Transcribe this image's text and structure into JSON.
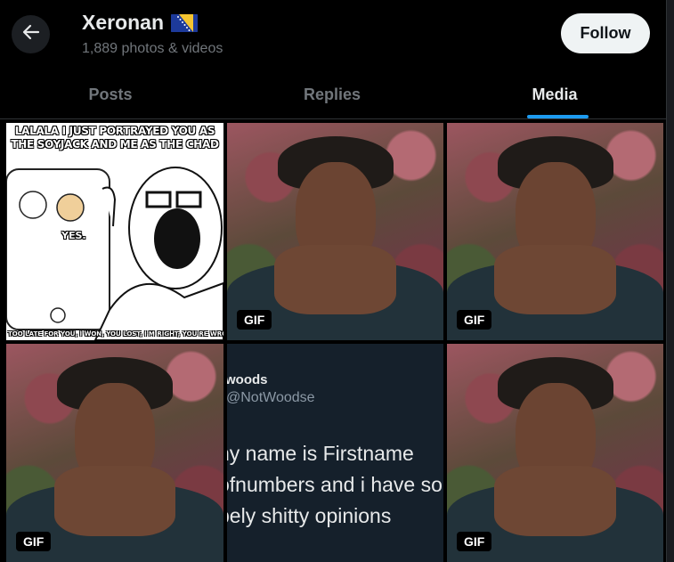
{
  "header": {
    "name": "Xeronan",
    "count": "1,889 photos & videos",
    "follow_label": "Follow"
  },
  "tabs": [
    {
      "label": "Posts",
      "active": false
    },
    {
      "label": "Replies",
      "active": false
    },
    {
      "label": "Media",
      "active": true
    }
  ],
  "accent_color": "#1d9bf0",
  "media": [
    {
      "kind": "meme",
      "top_text": "LALALA I JUST PORTRAYED YOU AS THE SOYJACK AND ME AS THE CHAD",
      "yes_text": "YES.",
      "bottom_text": "TOO LATE FOR YOU, I WON, YOU LOST, I'M RIGHT, YOU'RE WRONG, LALALA"
    },
    {
      "kind": "gif",
      "badge": "GIF"
    },
    {
      "kind": "gif",
      "badge": "GIF"
    },
    {
      "kind": "gif",
      "badge": "GIF"
    },
    {
      "kind": "tweet",
      "name": "woods",
      "handle": "@NotWoodse",
      "lines": [
        "ny name is Firstname",
        "ofnumbers and i have so",
        "bely shitty opinions"
      ]
    },
    {
      "kind": "gif",
      "badge": "GIF"
    }
  ]
}
